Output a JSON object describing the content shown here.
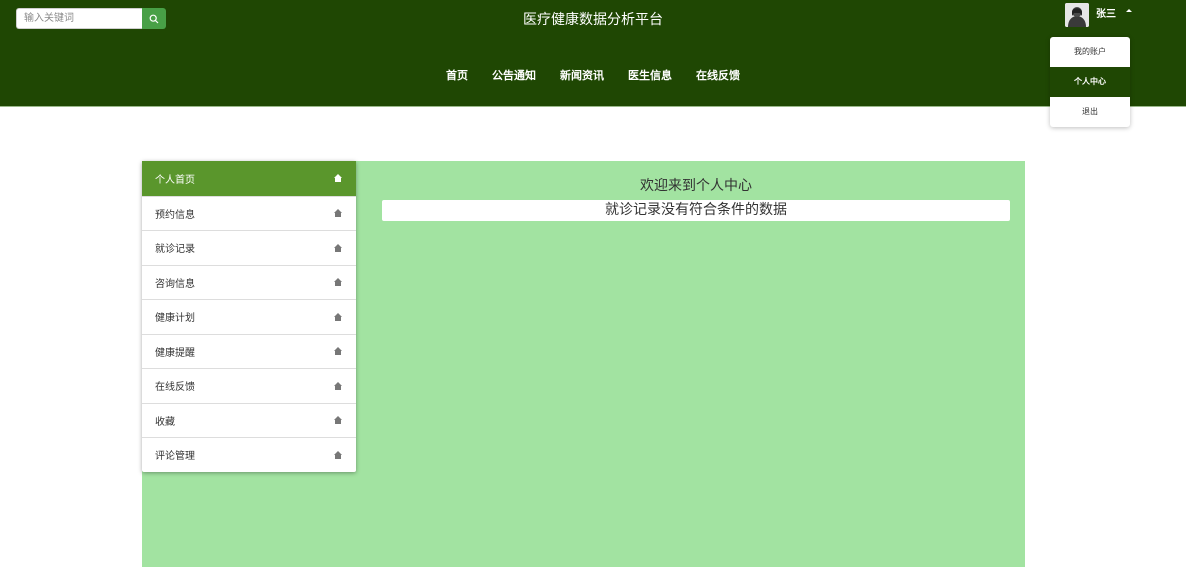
{
  "header": {
    "search_placeholder": "输入关键词",
    "title": "医疗健康数据分析平台",
    "nav": [
      "首页",
      "公告通知",
      "新闻资讯",
      "医生信息",
      "在线反馈"
    ],
    "username": "张三"
  },
  "user_menu": [
    "我的账户",
    "个人中心",
    "退出"
  ],
  "sidebar": {
    "items": [
      {
        "label": "个人首页",
        "icon": "home-icon"
      },
      {
        "label": "预约信息",
        "icon": "home-icon"
      },
      {
        "label": "就诊记录",
        "icon": "home-icon"
      },
      {
        "label": "咨询信息",
        "icon": "home-icon"
      },
      {
        "label": "健康计划",
        "icon": "home-icon"
      },
      {
        "label": "健康提醒",
        "icon": "home-icon"
      },
      {
        "label": "在线反馈",
        "icon": "home-icon"
      },
      {
        "label": "收藏",
        "icon": "home-icon"
      },
      {
        "label": "评论管理",
        "icon": "home-icon"
      }
    ]
  },
  "main": {
    "welcome": "欢迎来到个人中心",
    "records_message": "就诊记录没有符合条件的数据"
  },
  "colors": {
    "header_bg": "#1f4703",
    "accent": "#5a962c",
    "search_button": "#48a046",
    "content_bg": "#a2e3a1"
  }
}
